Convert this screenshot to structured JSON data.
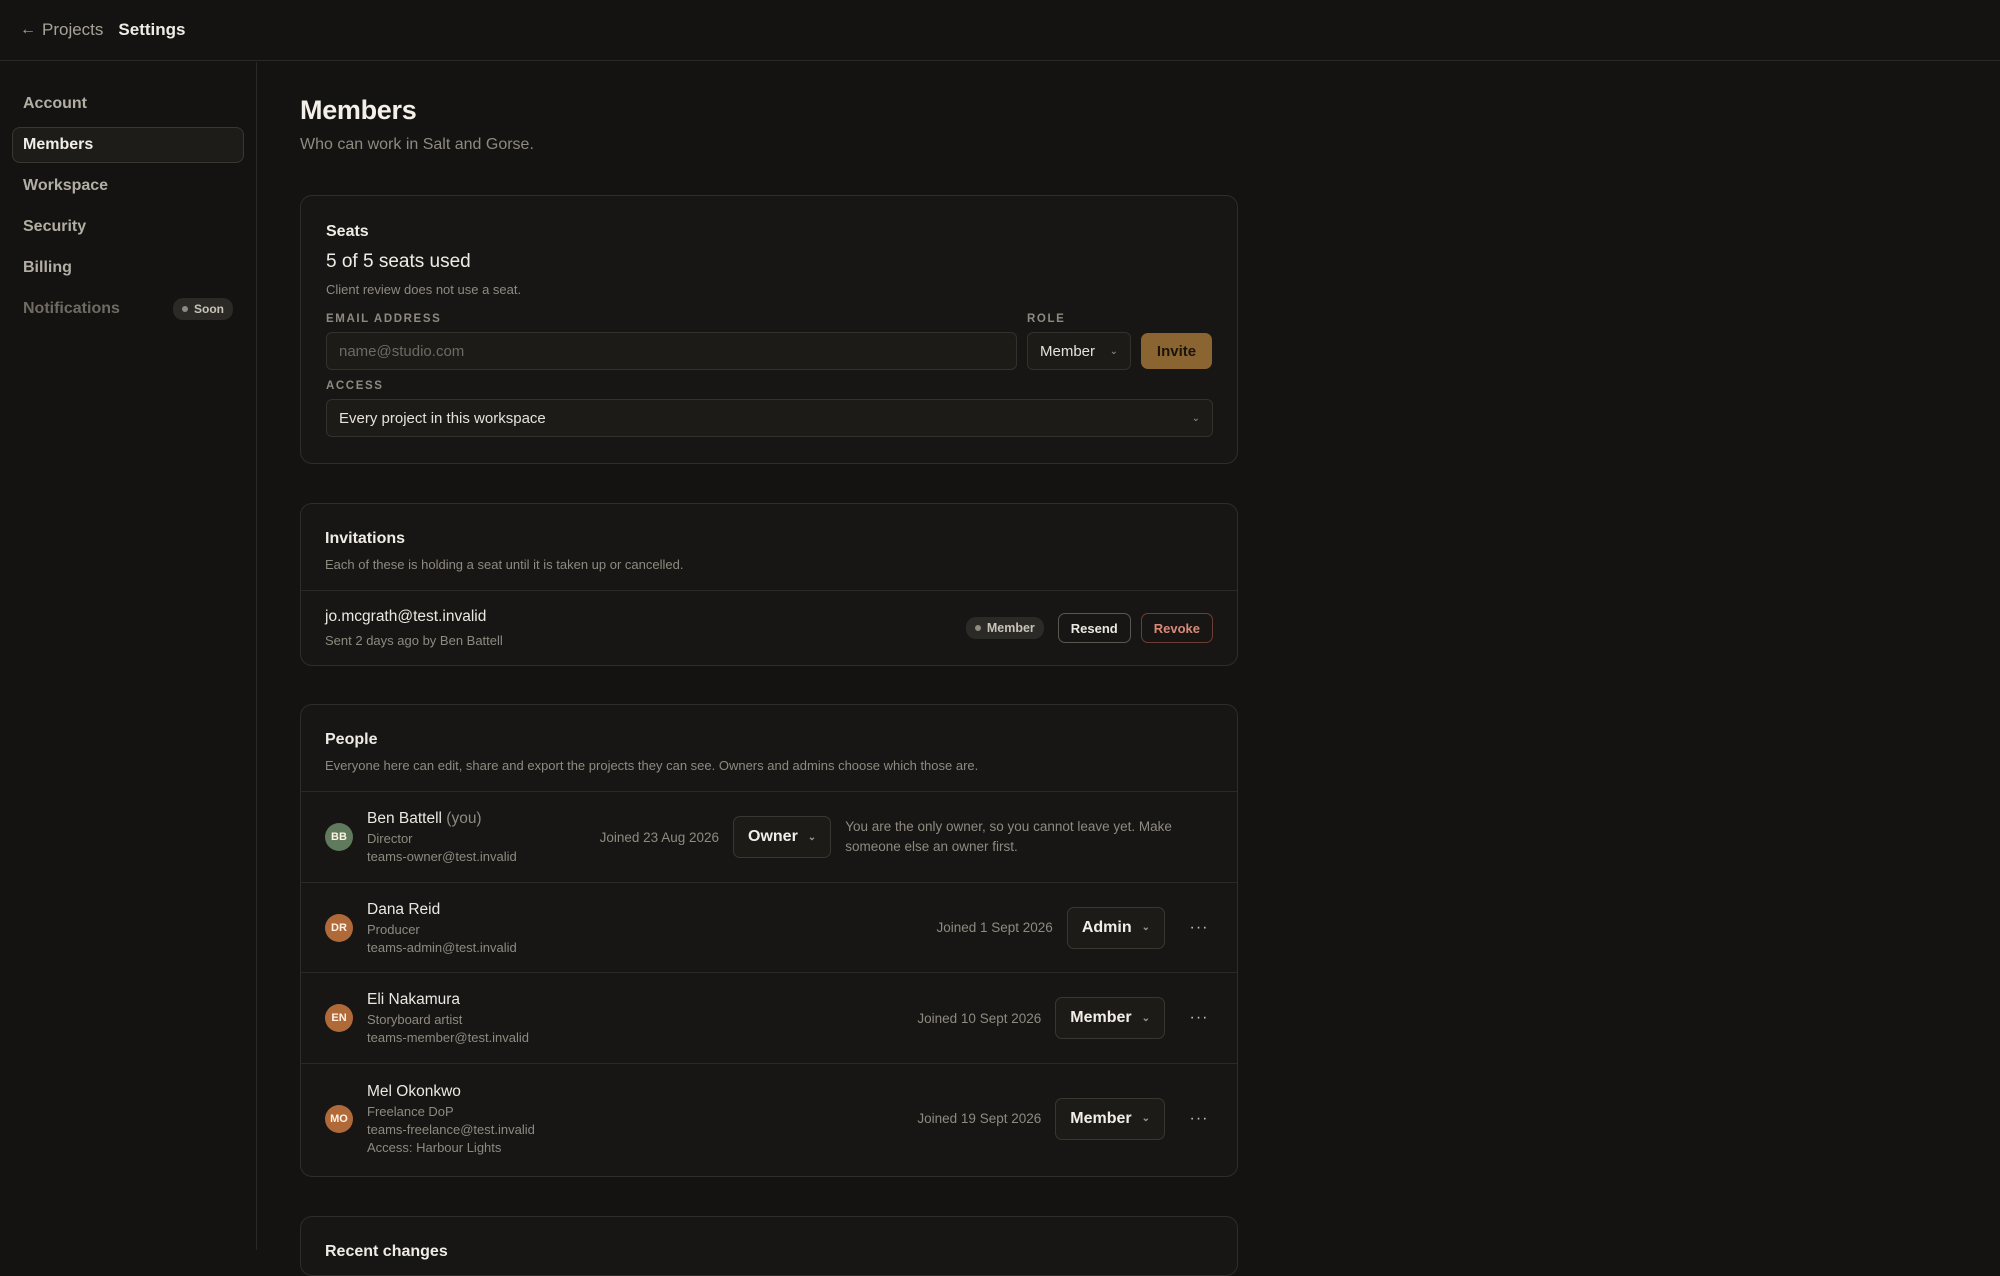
{
  "topbar": {
    "back_label": "Projects",
    "title": "Settings"
  },
  "sidebar": {
    "items": [
      {
        "label": "Account"
      },
      {
        "label": "Members"
      },
      {
        "label": "Workspace"
      },
      {
        "label": "Security"
      },
      {
        "label": "Billing"
      },
      {
        "label": "Notifications",
        "badge": "Soon"
      }
    ]
  },
  "page": {
    "title": "Members",
    "subtitle": "Who can work in Salt and Gorse."
  },
  "seats": {
    "title": "Seats",
    "count": "5 of 5 seats used",
    "note": "Client review does not use a seat.",
    "email_label": "EMAIL ADDRESS",
    "email_placeholder": "name@studio.com",
    "role_label": "ROLE",
    "role_value": "Member",
    "invite_label": "Invite",
    "access_label": "ACCESS",
    "access_value": "Every project in this workspace"
  },
  "invitations": {
    "title": "Invitations",
    "desc": "Each of these is holding a seat until it is taken up or cancelled.",
    "items": [
      {
        "email": "jo.mcgrath@test.invalid",
        "meta": "Sent 2 days ago by Ben Battell",
        "role": "Member",
        "resend": "Resend",
        "revoke": "Revoke"
      }
    ]
  },
  "people": {
    "title": "People",
    "desc": "Everyone here can edit, share and export the projects they can see. Owners and admins choose which those are.",
    "members": [
      {
        "initials": "BB",
        "name": "Ben Battell",
        "you": "(you)",
        "title": "Director",
        "email": "teams-owner@test.invalid",
        "joined": "Joined 23 Aug 2026",
        "role": "Owner",
        "note": "You are the only owner, so you cannot leave yet. Make someone else an owner first.",
        "avatar_color": "#5f7a5c"
      },
      {
        "initials": "DR",
        "name": "Dana Reid",
        "title": "Producer",
        "email": "teams-admin@test.invalid",
        "joined": "Joined 1 Sept 2026",
        "role": "Admin",
        "more": "···",
        "avatar_color": "#b06a3a"
      },
      {
        "initials": "EN",
        "name": "Eli Nakamura",
        "title": "Storyboard artist",
        "email": "teams-member@test.invalid",
        "joined": "Joined 10 Sept 2026",
        "role": "Member",
        "more": "···",
        "avatar_color": "#b06a3a"
      },
      {
        "initials": "MO",
        "name": "Mel Okonkwo",
        "title": "Freelance DoP",
        "email": "teams-freelance@test.invalid",
        "access": "Access: Harbour Lights",
        "joined": "Joined 19 Sept 2026",
        "role": "Member",
        "more": "···",
        "avatar_color": "#b06a3a"
      }
    ]
  },
  "recent": {
    "title": "Recent changes"
  },
  "colors": {
    "accent": "#8a6532",
    "background": "#141311",
    "revoke": "#d98a77"
  }
}
